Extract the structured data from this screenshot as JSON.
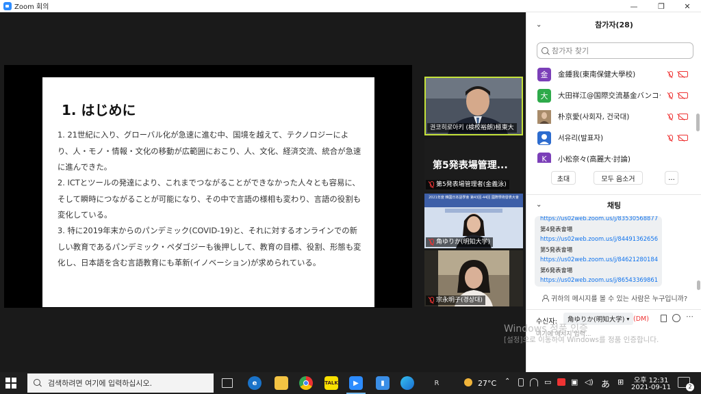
{
  "window": {
    "title": "Zoom 회의",
    "minimize": "—",
    "restore": "❐",
    "close": "✕"
  },
  "slide": {
    "heading": "1. はじめに",
    "paragraphs": [
      "1. 21世紀に入り、グローバル化が急速に進む中、国境を越えて、テクノロジーにより、人・モノ・情報・文化の移動が広範囲におこり、人、文化、経済交流、統合が急速に進んできた。",
      "2. ICTとツールの発達により、これまでつながることができなかった人々とも容易に、そして瞬時につながることが可能になり、その中で言語の様相も変わり、言語の役割も変化している。",
      "3. 特に2019年末からのパンデミック(COVID-19)と、それに対するオンラインでの新しい教育であるパンデミック・ペダゴジーも後押しして、教育の目標、役割、形態も変化し、日本語を含む言語教育にも革新(イノベーション)が求められている。"
    ]
  },
  "video_tiles": [
    {
      "label": "권코히로아키 (検校裕朗)極東大"
    },
    {
      "big_name": "第5発表場管理...",
      "label": "第5発表場管理者(金義泳)"
    },
    {
      "label": "角ゆりか(明知大学)",
      "banner": "2021年度 韓國日本語學會 第43回·44回 國際學術發表大會"
    },
    {
      "label": "宗永明子(경상대)"
    }
  ],
  "participants": {
    "title": "참가자(28)",
    "search_placeholder": "참가자 찾기",
    "list": [
      {
        "name": "金鍾我(東南保健大學校)",
        "avatar_text": "金",
        "color": "#7b3fb8"
      },
      {
        "name": "大田祥江@国際交流基金バンコク",
        "avatar_text": "大",
        "color": "#2eaa4a"
      },
      {
        "name": "朴京愛(사회자, 건국대)",
        "avatar_text": "",
        "color": "#a88b6a"
      },
      {
        "name": "서유리(발표자)",
        "avatar_text": "",
        "color": "#2d6ccf"
      },
      {
        "name": "小松奈々(高麗大·討論)",
        "avatar_text": "K",
        "color": "#7b3fb8"
      }
    ],
    "buttons": {
      "invite": "초대",
      "mute_all": "모두 음소거",
      "more": "..."
    }
  },
  "chat": {
    "title": "채팅",
    "lines": [
      {
        "text": "https://us02web.zoom.us/j/83530568877",
        "type": "link"
      },
      {
        "text": "第4発表會場",
        "type": "txt"
      },
      {
        "text": "https://us02web.zoom.us/j/84491362656",
        "type": "link"
      },
      {
        "text": "第5発表會場",
        "type": "txt"
      },
      {
        "text": "https://us02web.zoom.us/j/84621280184",
        "type": "link"
      },
      {
        "text": "第6発表會場",
        "type": "txt"
      },
      {
        "text": "https://us02web.zoom.us/j/86543369861",
        "type": "link"
      }
    ],
    "visibility_text": "귀하의 메시지를 볼 수 있는 사람은 누구입니까?",
    "recipient_label": "수신자:",
    "recipient_value": "角ゆりか(明知大学)",
    "dm_badge": "(DM)",
    "placeholder": "여기에 메시지 입력..."
  },
  "watermark": {
    "line1": "Windows 정품 인증",
    "line2": "[설정]으로 이동하여 Windows를 정품 인증합니다."
  },
  "taskbar": {
    "search_placeholder": "검색하려면 여기에 입력하십시오.",
    "weather": "27°C",
    "time": "오후 12:31",
    "date": "2021-09-11",
    "ime": "あ",
    "notifications": "2",
    "apps": [
      "task-view",
      "edge-legacy",
      "file-explorer",
      "chrome",
      "kakaotalk",
      "zoom",
      "app-blue",
      "edge",
      "app-r"
    ]
  }
}
